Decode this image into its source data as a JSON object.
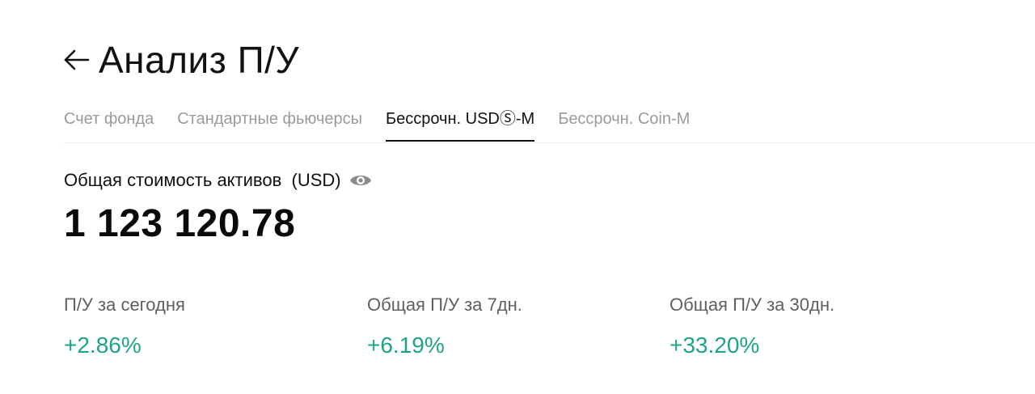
{
  "header": {
    "title": "Анализ П/У",
    "back_icon": "arrow-left-icon"
  },
  "tabs": [
    {
      "label": "Счет фонда",
      "active": false
    },
    {
      "label": "Стандартные фьючерсы",
      "active": false
    },
    {
      "label": "Бессрочн. USDⓈ-M",
      "active": true
    },
    {
      "label": "Бессрочн. Coin-M",
      "active": false
    }
  ],
  "assets": {
    "label": "Общая стоимость активов  (USD)",
    "visibility_icon": "eye-icon",
    "value": "1 123 120.78"
  },
  "stats": [
    {
      "label": "П/У за сегодня",
      "value": "+2.86%"
    },
    {
      "label": "Общая П/У за 7дн.",
      "value": "+6.19%"
    },
    {
      "label": "Общая П/У за 30дн.",
      "value": "+33.20%"
    }
  ],
  "colors": {
    "positive": "#1fa38a",
    "text_primary": "#111111",
    "text_secondary": "#5f5f5f",
    "tab_inactive": "#9a9a9a"
  }
}
